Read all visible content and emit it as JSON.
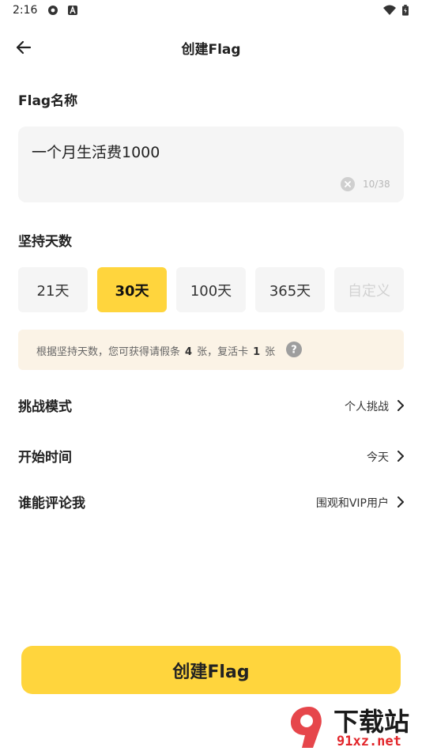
{
  "status_bar": {
    "time": "2:16",
    "icons": [
      "settings-gear-icon",
      "text-a-icon",
      "wifi-icon",
      "battery-icon"
    ]
  },
  "app_bar": {
    "title": "创建Flag",
    "back_icon": "arrow-left-icon"
  },
  "flag_name": {
    "label": "Flag名称",
    "value": "一个月生活费1000",
    "counter": "10/38",
    "clear_icon": "clear-circle-icon"
  },
  "duration": {
    "label": "坚持天数",
    "options": [
      {
        "label": "21天",
        "selected": false,
        "enabled": true
      },
      {
        "label": "30天",
        "selected": true,
        "enabled": true
      },
      {
        "label": "100天",
        "selected": false,
        "enabled": true
      },
      {
        "label": "365天",
        "selected": false,
        "enabled": true
      },
      {
        "label": "自定义",
        "selected": false,
        "enabled": false
      }
    ]
  },
  "tip": {
    "prefix": "根据坚持天数，您可获得请假条",
    "leave_count": "4",
    "middle": "张，复活卡",
    "revive_count": "1",
    "suffix": "张",
    "help_icon": "question-circle-icon"
  },
  "settings": [
    {
      "label": "挑战模式",
      "value": "个人挑战"
    },
    {
      "label": "开始时间",
      "value": "今天"
    },
    {
      "label": "谁能评论我",
      "value": "围观和VIP用户"
    }
  ],
  "submit_button": {
    "label": "创建Flag"
  },
  "watermark": {
    "top": "下载站",
    "bottom": "91xz.net"
  },
  "colors": {
    "accent": "#ffd53d",
    "field_bg": "#f5f5f5",
    "tip_bg": "#fbf3e6",
    "watermark_red": "#e2262b"
  }
}
